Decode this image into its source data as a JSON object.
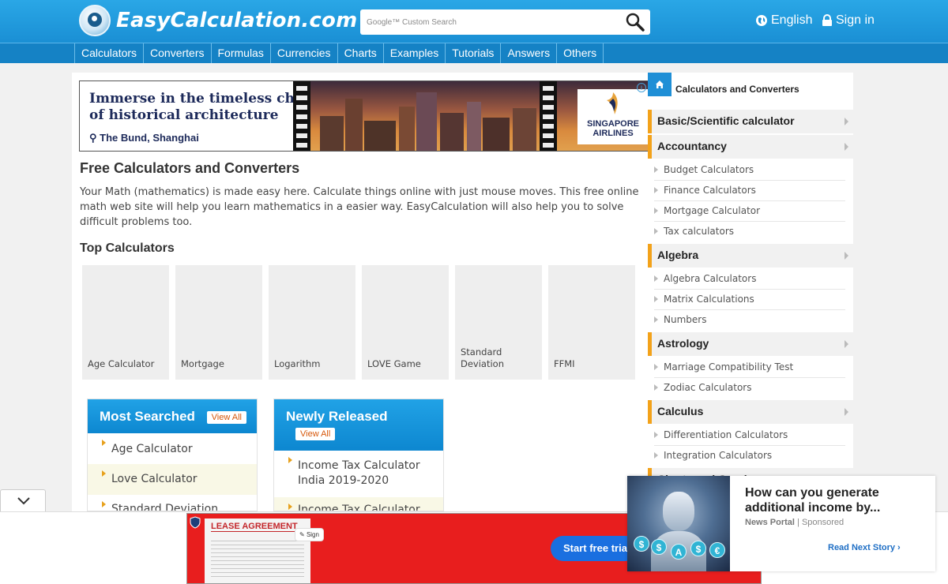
{
  "header": {
    "site_name": "EasyCalculation.com",
    "search_placeholder": "Google™ Custom Search",
    "language": "English",
    "sign_in": "Sign in"
  },
  "nav": [
    "Calculators",
    "Converters",
    "Formulas",
    "Currencies",
    "Charts",
    "Examples",
    "Tutorials",
    "Answers",
    "Others"
  ],
  "top_ad": {
    "headline_line1": "Immerse in the timeless charm",
    "headline_line2": "of historical architecture",
    "location": "The Bund, Shanghai",
    "brand_line1": "SINGAPORE",
    "brand_line2": "AIRLINES",
    "info_icon": "i"
  },
  "main": {
    "title": "Free Calculators and Converters",
    "intro": "Your Math (mathematics) is made easy here. Calculate things online with just mouse moves. This free online math web site will help you learn mathematics in a easier way. EasyCalculation will also help you to solve difficult problems too.",
    "top_calculators_heading": "Top Calculators",
    "tiles": [
      "Age Calculator",
      "Mortgage",
      "Logarithm",
      "LOVE Game",
      "Standard Deviation",
      "FFMI"
    ]
  },
  "most_searched": {
    "title": "Most Searched",
    "view_all": "View All",
    "items": [
      "Age Calculator",
      "Love Calculator",
      "Standard Deviation"
    ]
  },
  "newly_released": {
    "title": "Newly Released",
    "view_all": "View All",
    "items": [
      "Income Tax Calculator India 2019-2020",
      "Income Tax Calculator"
    ]
  },
  "sidebar": {
    "title": "Calculators and Converters",
    "categories": [
      {
        "label": "Basic/Scientific calculator",
        "subs": []
      },
      {
        "label": "Accountancy",
        "subs": [
          "Budget Calculators",
          "Finance Calculators",
          "Mortgage Calculator",
          "Tax calculators"
        ]
      },
      {
        "label": "Algebra",
        "subs": [
          "Algebra Calculators",
          "Matrix Calculations",
          "Numbers"
        ]
      },
      {
        "label": "Astrology",
        "subs": [
          "Marriage Compatibility Test",
          "Zodiac Calculators"
        ]
      },
      {
        "label": "Calculus",
        "subs": [
          "Differentiation Calculators",
          "Integration Calculators"
        ]
      },
      {
        "label": "Charts and Graphs",
        "subs": []
      }
    ]
  },
  "bottom_ad": {
    "doc_title": "LEASE AGREEMENT",
    "sign_label": "Sign",
    "cta": "Start free trial"
  },
  "native_ad": {
    "headline": "How can you generate additional income by...",
    "source": "News Portal",
    "sponsored": "Sponsored",
    "cta": "Read Next Story",
    "coin_labels": [
      "$",
      "$",
      "A",
      "$",
      "€"
    ]
  },
  "colors": {
    "header_blue": "#1a8fd4",
    "nav_blue": "#1582c5",
    "accent_orange": "#f3a21a",
    "ad_red": "#e81e1e"
  }
}
